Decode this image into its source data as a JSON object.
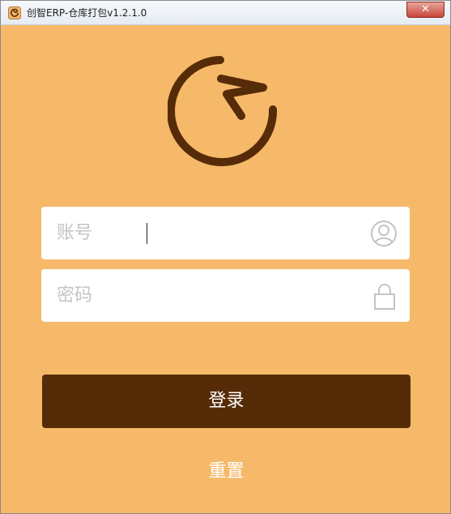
{
  "window": {
    "title": "创智ERP-仓库打包v1.2.1.0",
    "close_label": "✕",
    "app_icon": "app-logo-icon"
  },
  "logo": {
    "icon": "clock-arrow-logo-icon",
    "color": "#562B07"
  },
  "form": {
    "account_placeholder": "账号",
    "account_value": "",
    "account_icon": "user-icon",
    "password_placeholder": "密码",
    "password_value": "",
    "password_icon": "lock-icon"
  },
  "actions": {
    "login_label": "登录",
    "reset_label": "重置"
  },
  "colors": {
    "background": "#F6B96A",
    "primary": "#562B07",
    "field_bg": "#FFFFFF",
    "placeholder": "#C4C4C4"
  }
}
